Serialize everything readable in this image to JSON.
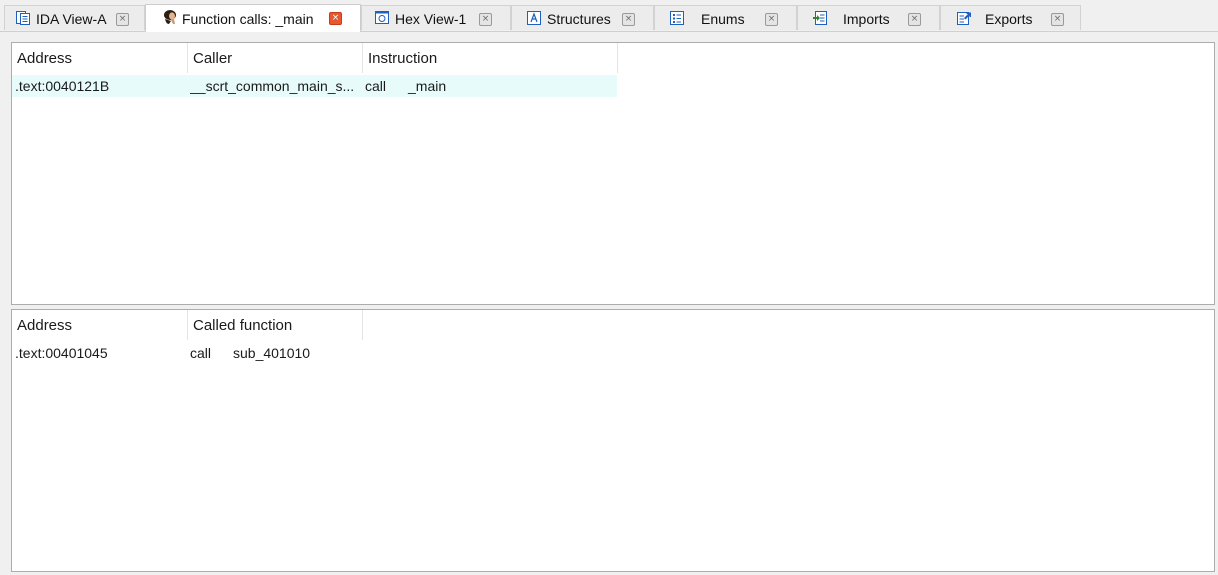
{
  "tabs": [
    {
      "label": "IDA View-A",
      "icon": "ida-view-icon",
      "close": "×",
      "active": false
    },
    {
      "label": "Function calls: _main",
      "icon": "function-calls-icon",
      "close": "×",
      "active": true
    },
    {
      "label": "Hex View-1",
      "icon": "hex-view-icon",
      "close": "×",
      "active": false
    },
    {
      "label": "Structures",
      "icon": "structures-icon",
      "close": "×",
      "active": false
    },
    {
      "label": "Enums",
      "icon": "enums-icon",
      "close": "×",
      "active": false
    },
    {
      "label": "Imports",
      "icon": "imports-icon",
      "close": "×",
      "active": false
    },
    {
      "label": "Exports",
      "icon": "exports-icon",
      "close": "×",
      "active": false
    }
  ],
  "callers": {
    "columns": [
      "Address",
      "Caller",
      "Instruction"
    ],
    "rows": [
      {
        "address": ".text:0040121B",
        "caller": "__scrt_common_main_s...",
        "mnemonic": "call",
        "operand": "_main",
        "selected": true
      }
    ]
  },
  "callees": {
    "columns": [
      "Address",
      "Called function"
    ],
    "rows": [
      {
        "address": ".text:00401045",
        "mnemonic": "call",
        "operand": "sub_401010",
        "selected": false
      }
    ]
  },
  "colors": {
    "selected_row": "#e8fbfb",
    "active_close": "#e8572f",
    "tab_icon_blue": "#1f5fbf"
  }
}
